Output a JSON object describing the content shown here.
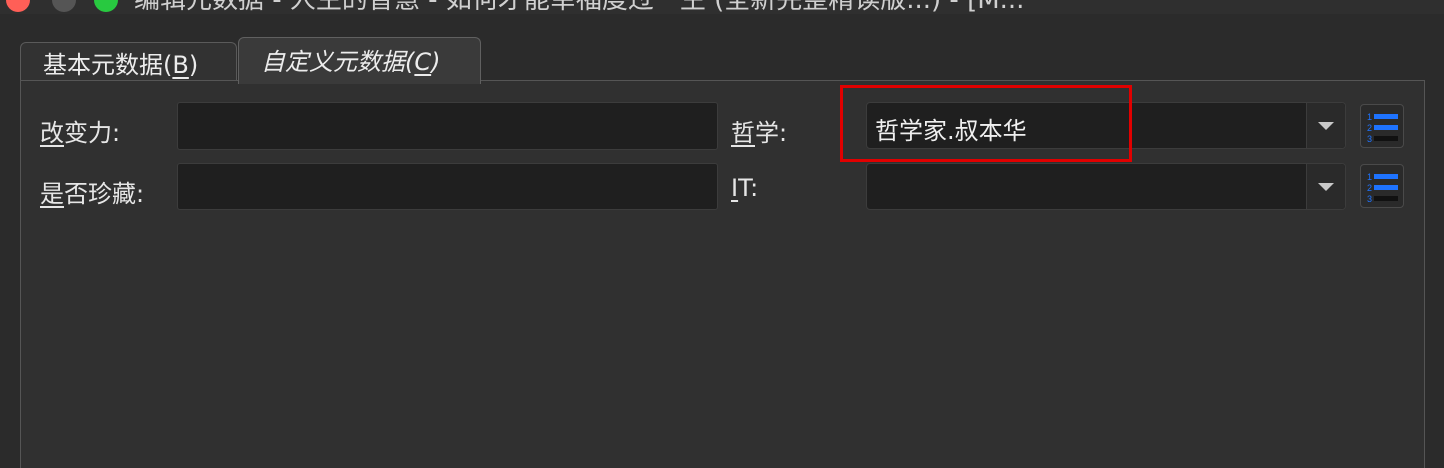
{
  "window": {
    "title": "编辑元数据 - 人生的智慧 - 如何才能幸福度过一生 (全新完整精读版...) - [M..."
  },
  "tabs": [
    {
      "label": "基本元数据(B)",
      "prefix": "基本元数据(",
      "key": "B",
      "suffix": ")"
    },
    {
      "label": "自定义元数据(C)",
      "prefix": "自定义元数据(",
      "key": "C",
      "suffix": ")"
    }
  ],
  "fields": {
    "change_power": {
      "label_key": "改",
      "label_rest": "变力:",
      "value": ""
    },
    "is_collected": {
      "label_key": "是",
      "label_rest": "否珍藏:",
      "value": ""
    },
    "philosophy": {
      "label_key": "哲",
      "label_rest": "学:",
      "value": "哲学家.叔本华"
    },
    "it": {
      "label_key": "I",
      "label_rest": "T:",
      "value": ""
    }
  },
  "colors": {
    "highlight": "#e10000",
    "icon_blue": "#1e73ff"
  },
  "icons": {
    "list_button": "numbered-list-icon",
    "dropdown": "chevron-down-icon"
  }
}
